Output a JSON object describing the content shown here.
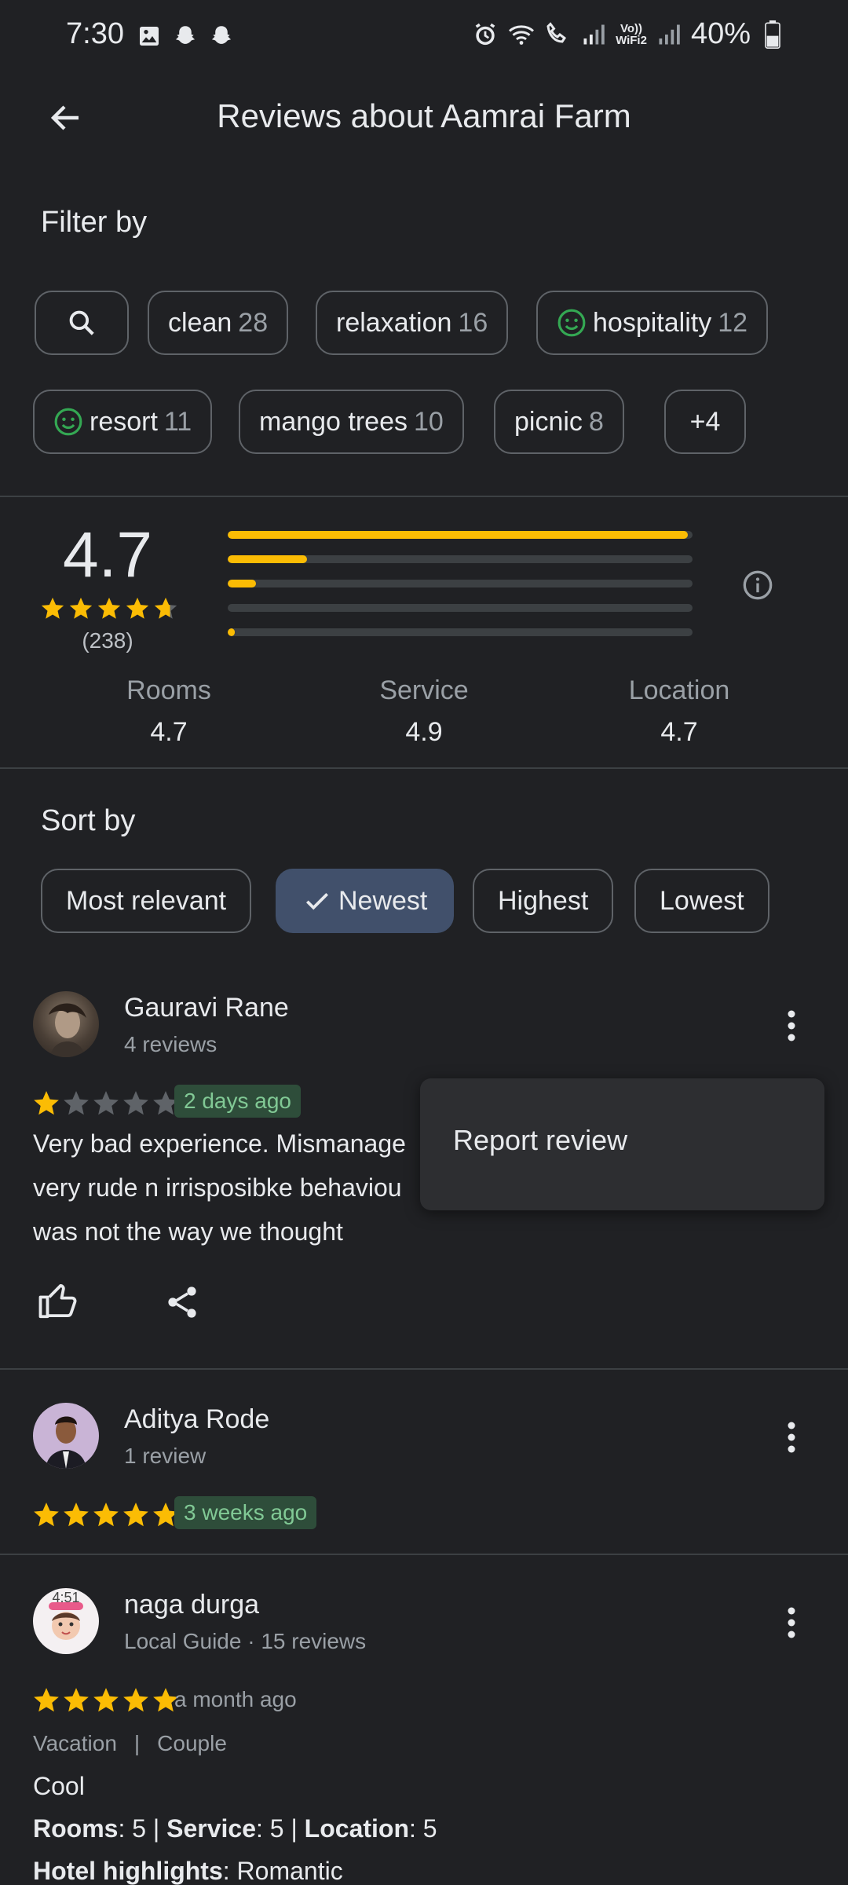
{
  "status_bar": {
    "time": "7:30",
    "battery": "40%",
    "vowifi": "Vo))\nWiFi2"
  },
  "header": {
    "title": "Reviews about Aamrai Farm",
    "back_icon": "arrow-left-icon"
  },
  "filter": {
    "label": "Filter by",
    "chips": [
      {
        "label": "clean",
        "count": "28"
      },
      {
        "label": "relaxation",
        "count": "16"
      },
      {
        "label": "hospitality",
        "count": "12",
        "icon": "smile-icon"
      },
      {
        "label": "resort",
        "count": "11",
        "icon": "smile-icon"
      },
      {
        "label": "mango trees",
        "count": "10"
      },
      {
        "label": "picnic",
        "count": "8"
      },
      {
        "label": "+4",
        "count": ""
      }
    ]
  },
  "rating": {
    "overall": "4.7",
    "stars": 4.7,
    "total": "(238)",
    "distribution": [
      0.99,
      0.17,
      0.06,
      0.0,
      0.015
    ],
    "aspects": [
      {
        "label": "Rooms",
        "value": "4.7"
      },
      {
        "label": "Service",
        "value": "4.9"
      },
      {
        "label": "Location",
        "value": "4.7"
      }
    ]
  },
  "sort": {
    "label": "Sort by",
    "options": [
      "Most relevant",
      "Newest",
      "Highest",
      "Lowest"
    ],
    "selected": "Newest"
  },
  "reviews": [
    {
      "name": "Gauravi Rane",
      "meta": "4 reviews",
      "stars": 1,
      "time": "2 days ago",
      "text": [
        "Very bad experience. Mismanage",
        "very rude n irrisposibke behaviou",
        "was not the way we thought"
      ]
    },
    {
      "name": "Aditya Rode",
      "meta": "1 review",
      "stars": 5,
      "time": "3 weeks ago"
    },
    {
      "name": "naga durga",
      "meta": "Local Guide · 15 reviews",
      "stars": 5,
      "time": "a month ago",
      "avatar_text": "4:51",
      "tags": [
        "Vacation",
        "Couple"
      ],
      "text": "Cool",
      "ratings_line": {
        "rooms_label": "Rooms",
        "rooms": "5",
        "service_label": "Service",
        "service": "5",
        "location_label": "Location",
        "location": "5"
      },
      "highlights_label": "Hotel highlights",
      "highlights": "Romantic"
    }
  ],
  "popup": {
    "item": "Report review"
  },
  "colors": {
    "background": "#202124",
    "star": "#fbbc04",
    "selected_chip": "#41506b",
    "badge_bg": "#2e4d3a",
    "badge_text": "#81c995",
    "smile": "#34a853"
  }
}
